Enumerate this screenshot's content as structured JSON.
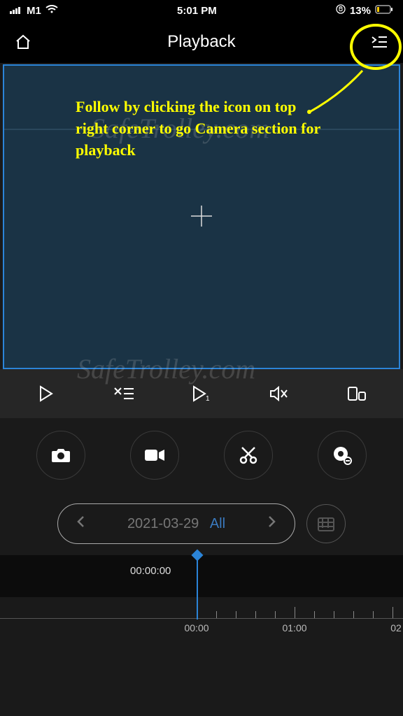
{
  "status": {
    "carrier": "M1",
    "time": "5:01 PM",
    "battery": "13%"
  },
  "nav": {
    "title": "Playback"
  },
  "annotation": {
    "text": "Follow by clicking the icon on top right corner to go Camera section for playback"
  },
  "watermark": "SafeTrolley.com",
  "date": {
    "value": "2021-03-29",
    "filter": "All"
  },
  "timeline": {
    "current": "00:00:00",
    "ticks": [
      "00:00",
      "01:00",
      "02"
    ]
  }
}
